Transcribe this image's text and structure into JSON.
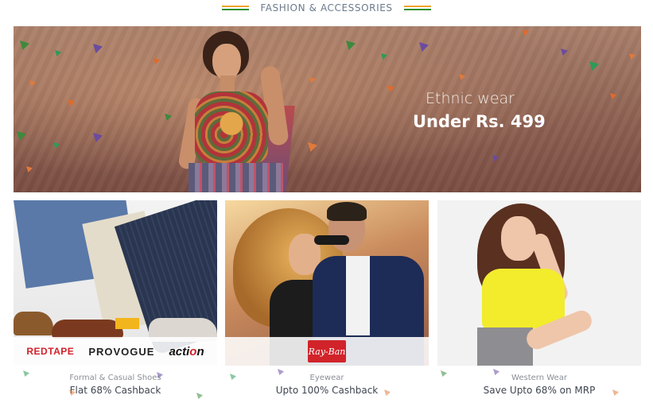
{
  "section": {
    "heading": "FASHION & ACCESSORIES"
  },
  "hero": {
    "line1": "Ethnic wear",
    "line2": "Under Rs. 499"
  },
  "tiles": [
    {
      "brands": [
        "REDTAPE",
        "PROVOGUE",
        "acti",
        "n"
      ],
      "title": "Formal & Casual Shoes",
      "offer": "Flat 68% Cashback"
    },
    {
      "brands": [
        "Ray-Ban"
      ],
      "title": "Eyewear",
      "offer": "Upto 100% Cashback"
    },
    {
      "brands": [],
      "title": "Western Wear",
      "offer": "Save Upto 68% on MRP"
    }
  ],
  "colors": {
    "flag_saffron": "#f0a52b",
    "flag_green": "#2f8f2f",
    "heading_text": "#6b7a8d",
    "redtape_red": "#d3202a",
    "rayban_red": "#d1232a",
    "caption_title": "#8a8f96",
    "caption_offer": "#3f4650"
  }
}
